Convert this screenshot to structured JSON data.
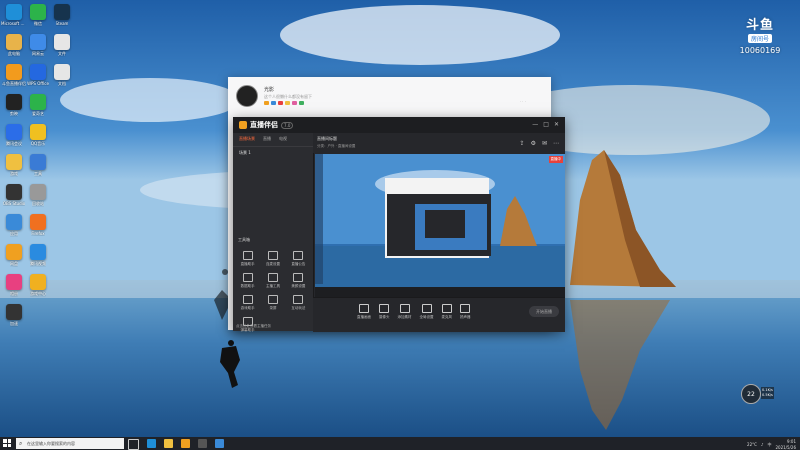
{
  "desktop": {
    "icons": [
      {
        "label": "Microsoft Edge",
        "icon": "edge-icon",
        "color": "#1f8fd8"
      },
      {
        "label": "微信",
        "icon": "wechat-icon",
        "color": "#2cb34a"
      },
      {
        "label": "Steam",
        "icon": "steam-icon",
        "color": "#16334d"
      },
      {
        "label": "此电脑",
        "icon": "computer-icon",
        "color": "#e8b34a"
      },
      {
        "label": "网易云",
        "icon": "cloud-icon",
        "color": "#3f8be8"
      },
      {
        "label": "文件",
        "icon": "file-icon",
        "color": "#e6e6e6"
      },
      {
        "label": "斗鱼直播伴侣",
        "icon": "game-icon",
        "color": "#f29b1d"
      },
      {
        "label": "WPS Office",
        "icon": "wps-icon",
        "color": "#2468e0"
      },
      {
        "label": "文档",
        "icon": "doc-icon",
        "color": "#e6e6e6"
      },
      {
        "label": "剪映",
        "icon": "capcut-icon",
        "color": "#222"
      },
      {
        "label": "爱奇艺",
        "icon": "iqiyi-icon",
        "color": "#2cb34a"
      },
      {
        "label": "加速器",
        "icon": "booster-icon",
        "color": "#1e5ad1"
      },
      {
        "label": "腾讯会议",
        "icon": "meeting-icon",
        "color": "#2b6de8"
      },
      {
        "label": "QQ音乐",
        "icon": "music-icon",
        "color": "#f0c020"
      },
      {
        "label": "Internet Explorer",
        "icon": "ie-icon",
        "color": "#2a8be0"
      },
      {
        "label": "游戏",
        "icon": "game2-icon",
        "color": "#f0c040"
      },
      {
        "label": "工具",
        "icon": "tool-icon",
        "color": "#3a7bd5"
      },
      {
        "label": "录屏",
        "icon": "record-icon",
        "color": "#d94040"
      },
      {
        "label": "OBS Studio",
        "icon": "obs-icon",
        "color": "#333"
      },
      {
        "label": "回收站",
        "icon": "recycle-icon",
        "color": "#999"
      },
      {
        "label": "GeForce",
        "icon": "geforce-icon",
        "color": "#f0b020"
      },
      {
        "label": "应用",
        "icon": "app-icon",
        "color": "#3a8ad8"
      },
      {
        "label": "Firefox",
        "icon": "firefox-icon",
        "color": "#f07020"
      },
      {
        "label": "360",
        "icon": "s360-icon",
        "color": "#2cb34a"
      },
      {
        "label": "网盘",
        "icon": "disk-icon",
        "color": "#f0a020"
      },
      {
        "label": "腾讯视频",
        "icon": "video-icon",
        "color": "#2a8be0"
      },
      {
        "label": "控制",
        "icon": "control-icon",
        "color": "#f0b020"
      },
      {
        "label": "相册",
        "icon": "photos-icon",
        "color": "#e84080"
      },
      {
        "label": "游戏中心",
        "icon": "gamecenter-icon",
        "color": "#f0b020"
      },
      {
        "label": "QQ",
        "icon": "qq-icon",
        "color": "#111"
      },
      {
        "label": "加速",
        "icon": "speed-icon",
        "color": "#333"
      }
    ]
  },
  "watermark": {
    "logo": "斗鱼",
    "tag": "房间号",
    "room": "10060169"
  },
  "profile_window": {
    "name": "光影",
    "subtitle": "这个人很懒什么都没有留下",
    "right_text": "· · ·"
  },
  "app": {
    "title": "直播伴侣",
    "version": "7.0",
    "window_controls": [
      "—",
      "□",
      "✕"
    ],
    "side_tabs": [
      "直播场景",
      "直播",
      "电视"
    ],
    "active_tab": "直播场景",
    "scene_item": "场景 1",
    "tools_title": "工具箱",
    "tools": [
      "直播助手",
      "连麦设置",
      "直播公告",
      "数据助手",
      "主播工具",
      "美颜设置",
      "游戏助手",
      "录屏",
      "互动玩法",
      "弹幕助手"
    ],
    "footer": "点击此处查看主播任务",
    "topbar_title": "直播间标题",
    "topbar_sub": "分类：户外 · 直播间设置",
    "live_badge": "直播中",
    "bottom_tools": [
      "直播画面",
      "摄像头",
      "添加素材",
      "全局设置",
      "麦克风",
      "扬声器"
    ],
    "start_button": "开始直播"
  },
  "taskbar": {
    "search_text": "在这里输入你要搜索的内容",
    "tray": [
      "22°C",
      "中"
    ],
    "time": "9:01",
    "date": "2021/5/26"
  },
  "speed_widget": {
    "value": "22",
    "up": "0.1K/s",
    "down": "0.5K/s"
  }
}
